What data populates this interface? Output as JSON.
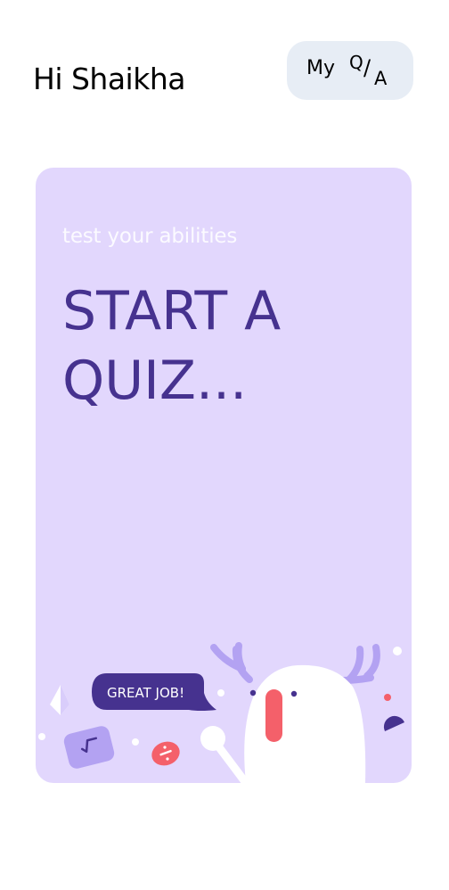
{
  "header": {
    "greeting": "Hi Shaikha",
    "qa_button": {
      "my": "My",
      "q": "Q",
      "slash": "/",
      "a": "A"
    }
  },
  "card": {
    "subtitle": "test your abilities",
    "title": "START A QUIZ...",
    "bubble_text": "GREAT JOB!",
    "colors": {
      "card_bg": "#e2d7fd",
      "title": "#46328f",
      "bubble": "#46328f",
      "mascot_mouth": "#f4606a"
    }
  }
}
